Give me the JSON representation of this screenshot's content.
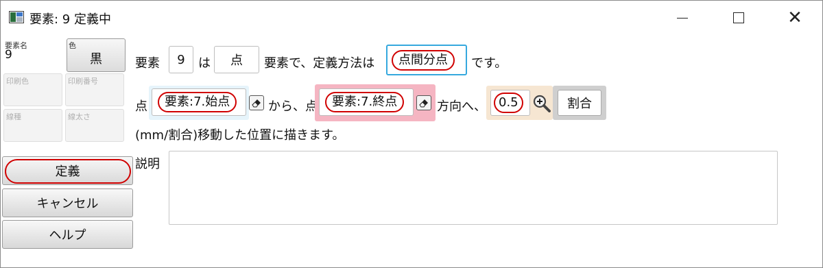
{
  "window": {
    "title": "要素: 9 定義中",
    "minimize_glyph": "",
    "maximize_glyph": "",
    "close_glyph": "✕"
  },
  "left_panel": {
    "element_name_label": "要素名",
    "element_name_value": "9",
    "color_label": "色",
    "color_value": "黒",
    "print_color_label": "印刷色",
    "print_number_label": "印刷番号",
    "line_type_label": "線種",
    "line_width_label": "線太さ",
    "define_button": "定義",
    "cancel_button": "キャンセル",
    "help_button": "ヘルプ"
  },
  "sentence1": {
    "prefix": "要素",
    "element_number": "9",
    "is": "は",
    "element_type": "点",
    "middle": "要素で、定義方法は",
    "method": "点間分点",
    "suffix": "です。"
  },
  "sentence2": {
    "point_label": "点",
    "from_point": "要素:7.始点",
    "from_text": "から、点",
    "to_point": "要素:7.終点",
    "direction_text": "方向へ、",
    "amount": "0.5",
    "ratio_button": "割合"
  },
  "sentence3": {
    "text": "(mm/割合)移動した位置に描きます。"
  },
  "description": {
    "label": "説明",
    "value": ""
  },
  "colors": {
    "highlight_ring": "#d00000",
    "method_border": "#35a8de",
    "from_bg": "#e6f4fb",
    "to_bg": "#f5b5c2",
    "amount_bg": "#f6e6d2",
    "ratio_bg": "#cfcfcf"
  },
  "icons": [
    "app-icon",
    "minimize-icon",
    "maximize-icon",
    "close-icon",
    "eraser-icon",
    "zoom-icon"
  ]
}
